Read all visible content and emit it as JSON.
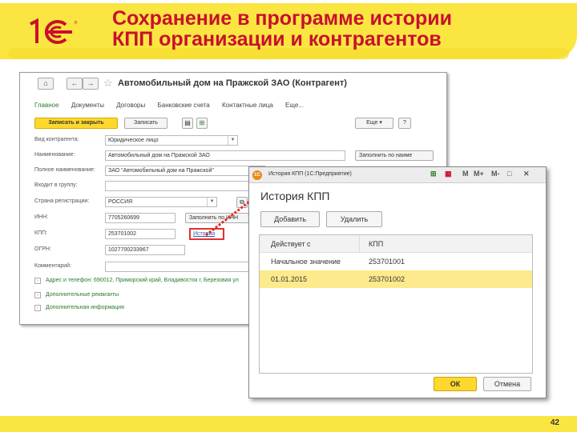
{
  "slide": {
    "title_line1": "Сохранение в программе истории",
    "title_line2": "КПП организации и контрагентов",
    "page_number": "42",
    "logo_text": "1С",
    "accent_color": "#c8102e",
    "banner_color": "#fbe641"
  },
  "main_window": {
    "title": "Автомобильный дом на Пражской ЗАО (Контрагент)",
    "nav": {
      "home_icon": "home-icon",
      "back_icon": "arrow-left-icon",
      "forward_icon": "arrow-right-icon",
      "favorite_icon": "star-icon"
    },
    "tabs": [
      "Главное",
      "Документы",
      "Договоры",
      "Банковские счета",
      "Контактные лица",
      "Еще..."
    ],
    "toolbar": {
      "save_close": "Записать и закрыть",
      "save": "Записать",
      "more": "Еще",
      "more_arrow": "▾",
      "help": "?"
    },
    "fields": {
      "type_label": "Вид контрагента:",
      "type_value": "Юридическое лицо",
      "name_label": "Наименование:",
      "name_value": "Автомобильный дом на Пражской ЗАО",
      "fill_by_name": "Заполнить по наиме",
      "fullname_label": "Полное наименование:",
      "fullname_value": "ЗАО \"Автомобильный дом на Пражской\"",
      "group_label": "Входит в группу:",
      "country_label": "Страна регистрации:",
      "country_value": "РОССИЯ",
      "inn_label": "ИНН:",
      "inn_value": "7705260699",
      "fill_by_inn": "Заполнить по ИНН",
      "kpp_label": "КПП:",
      "kpp_value": "253701002",
      "history_link": "История",
      "ogrn_label": "ОГРН:",
      "ogrn_value": "1027700233967",
      "comment_label": "Комментарий:"
    },
    "sections": [
      "Адрес и телефон: 690012, Приморский край, Владивосток г, Березовая ул",
      "Дополнительные реквизиты",
      "Дополнительная информация"
    ]
  },
  "popup": {
    "window_title": "История КПП (1С:Предприятие)",
    "window_controls": [
      "M",
      "M+",
      "M-",
      "□",
      "✕"
    ],
    "heading": "История КПП",
    "add_button": "Добавить",
    "delete_button": "Удалить",
    "columns": [
      "Действует с",
      "КПП"
    ],
    "rows": [
      {
        "date": "Начальное значение",
        "kpp": "253701001"
      },
      {
        "date": "01.01.2015",
        "kpp": "253701002"
      }
    ],
    "ok_button": "ОК",
    "cancel_button": "Отмена",
    "selected_row_color": "#fcea8c"
  }
}
